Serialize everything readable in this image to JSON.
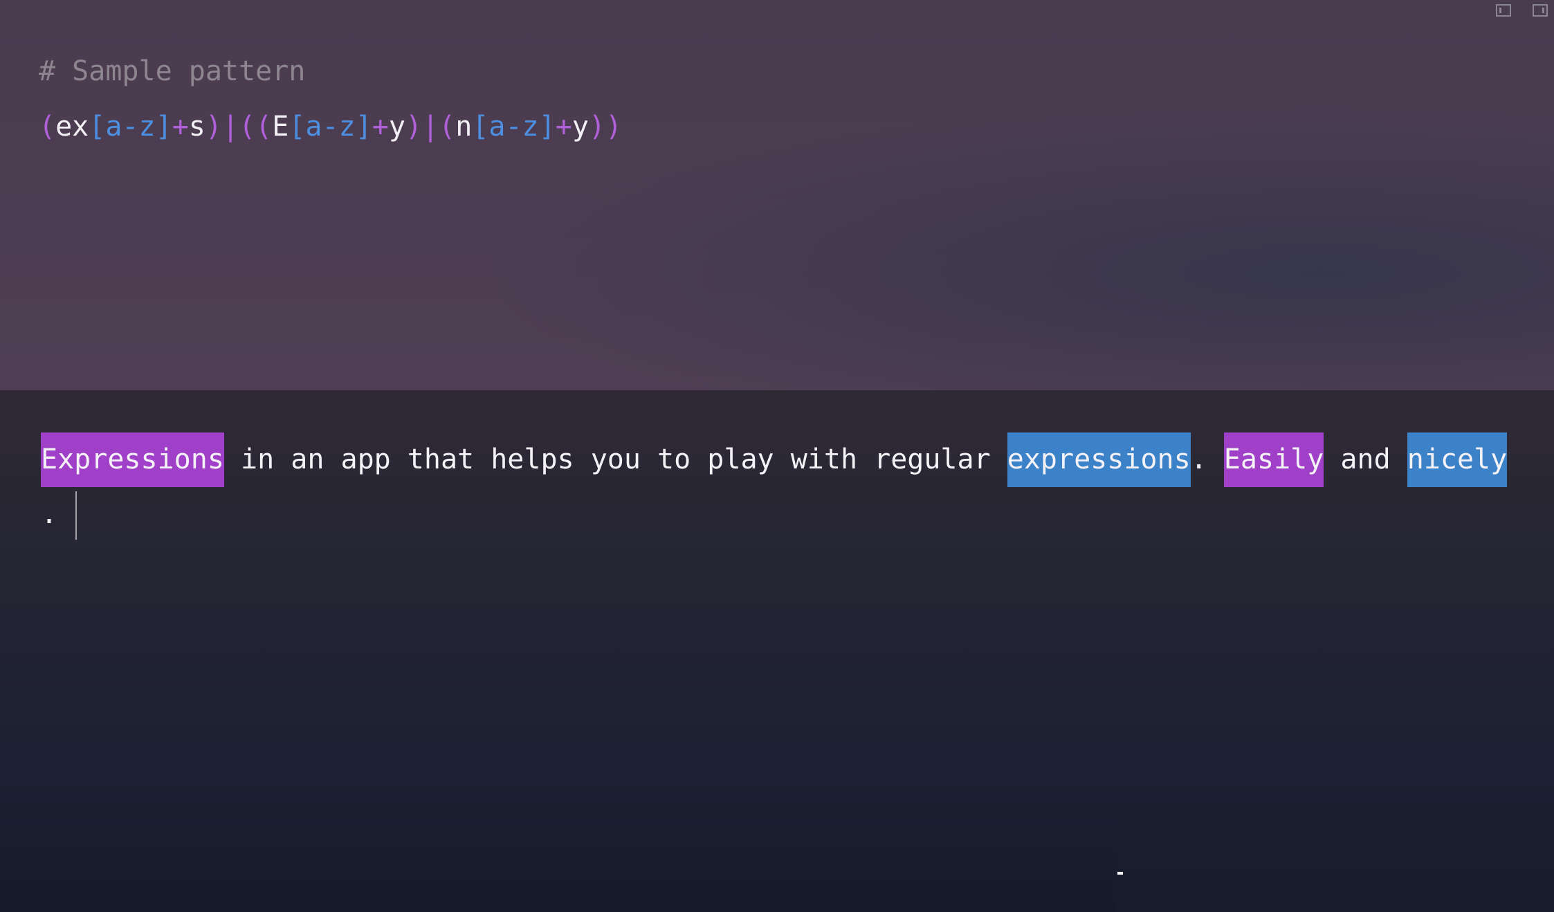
{
  "toolbar": {
    "left_pane_icon": "sidebar-left-icon",
    "right_pane_icon": "sidebar-right-icon"
  },
  "pattern_editor": {
    "comment": "# Sample pattern",
    "tokens": [
      {
        "t": "(",
        "k": "paren"
      },
      {
        "t": "ex",
        "k": "lit"
      },
      {
        "t": "[a-z]",
        "k": "class"
      },
      {
        "t": "+",
        "k": "quant"
      },
      {
        "t": "s",
        "k": "lit"
      },
      {
        "t": ")",
        "k": "paren"
      },
      {
        "t": "|",
        "k": "alt"
      },
      {
        "t": "((",
        "k": "paren"
      },
      {
        "t": "E",
        "k": "lit"
      },
      {
        "t": "[a-z]",
        "k": "class"
      },
      {
        "t": "+",
        "k": "quant"
      },
      {
        "t": "y",
        "k": "lit"
      },
      {
        "t": ")",
        "k": "paren"
      },
      {
        "t": "|",
        "k": "alt"
      },
      {
        "t": "(",
        "k": "paren"
      },
      {
        "t": "n",
        "k": "lit"
      },
      {
        "t": "[a-z]",
        "k": "class"
      },
      {
        "t": "+",
        "k": "quant"
      },
      {
        "t": "y",
        "k": "lit"
      },
      {
        "t": "))",
        "k": "paren"
      }
    ]
  },
  "test_text": {
    "segments": [
      {
        "t": "Expressions",
        "m": "purple"
      },
      {
        "t": " in an app that helps you to play with regular ",
        "m": ""
      },
      {
        "t": "expressions",
        "m": "blue"
      },
      {
        "t": ". ",
        "m": ""
      },
      {
        "t": "Easily",
        "m": "purple"
      },
      {
        "t": " and ",
        "m": ""
      },
      {
        "t": "nicely",
        "m": "blue"
      },
      {
        "t": ". ",
        "m": ""
      }
    ]
  },
  "colors": {
    "match_purple": "#a040c8",
    "match_blue": "#3c82c8",
    "class_blue": "#4c8ee0",
    "paren_purple": "#b060d8",
    "comment_gray": "#8d8691"
  }
}
